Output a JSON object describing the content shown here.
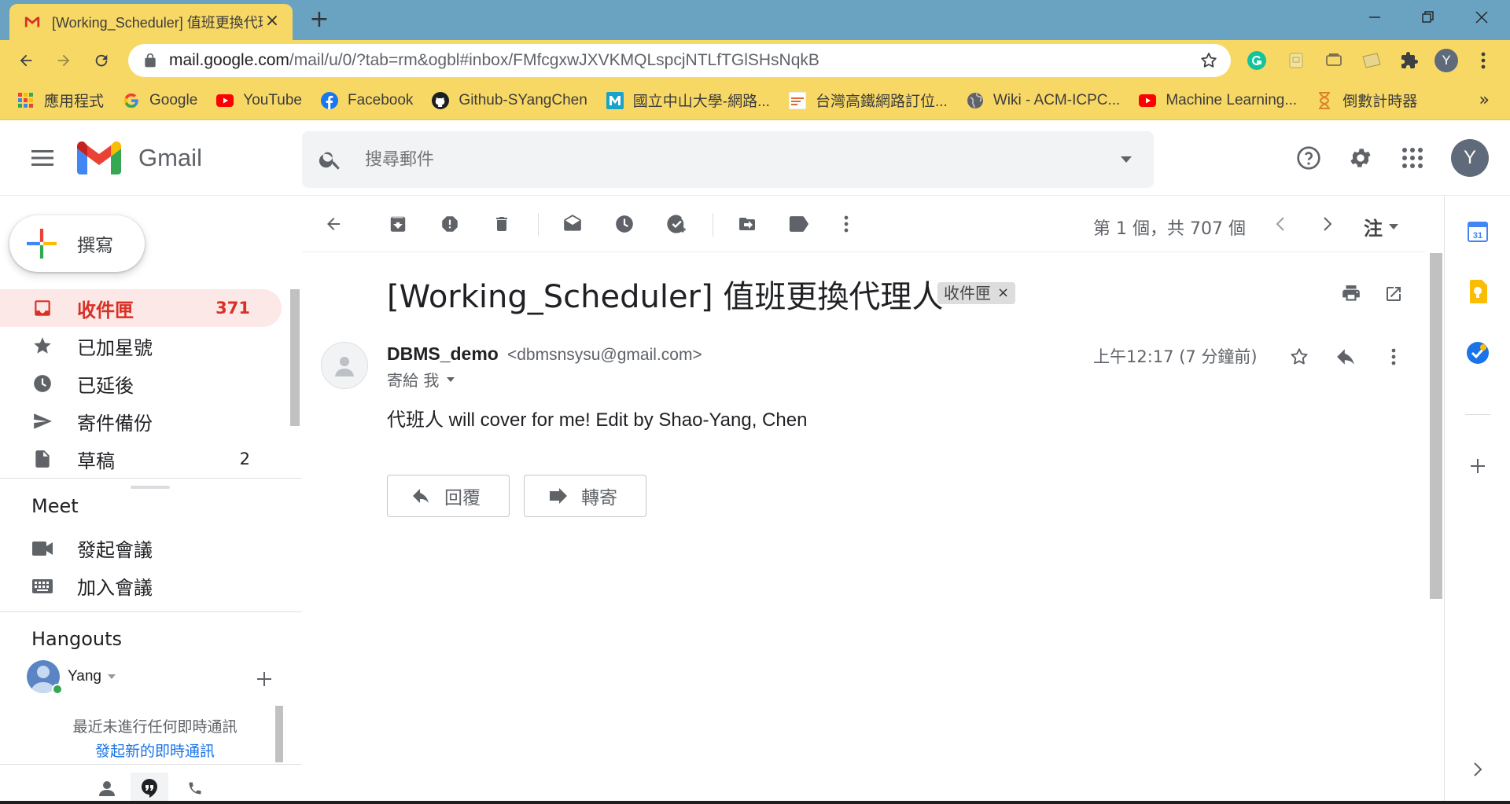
{
  "browser": {
    "tab_title": "[Working_Scheduler] 值班更換代理人 - dbmsnsysu@gmail.com - Gmail",
    "url_host": "mail.google.com",
    "url_path": "/mail/u/0/?tab=rm&ogbl#inbox/FMfcgxwJXVKMQLspcjNTLfTGlSHsNqkB",
    "profile_initial": "Y",
    "bookmarks": [
      {
        "label": "應用程式",
        "icon": "apps-grid-icon"
      },
      {
        "label": "Google",
        "icon": "google-icon"
      },
      {
        "label": "YouTube",
        "icon": "youtube-icon"
      },
      {
        "label": "Facebook",
        "icon": "facebook-icon"
      },
      {
        "label": "Github-SYangChen",
        "icon": "github-icon"
      },
      {
        "label": "國立中山大學-網路...",
        "icon": "m-icon"
      },
      {
        "label": "台灣高鐵網路訂位...",
        "icon": "thsr-icon"
      },
      {
        "label": "Wiki - ACM-ICPC...",
        "icon": "globe-icon"
      },
      {
        "label": "Machine Learning...",
        "icon": "youtube-icon"
      },
      {
        "label": "倒數計時器",
        "icon": "hourglass-icon"
      }
    ]
  },
  "gmail": {
    "brand": "Gmail",
    "search_placeholder": "搜尋郵件",
    "avatar_initial": "Y",
    "compose_label": "撰寫",
    "nav": [
      {
        "label": "收件匣",
        "count": "371",
        "icon": "inbox-icon",
        "active": true
      },
      {
        "label": "已加星號",
        "count": "",
        "icon": "star-icon"
      },
      {
        "label": "已延後",
        "count": "",
        "icon": "clock-icon"
      },
      {
        "label": "寄件備份",
        "count": "",
        "icon": "send-icon"
      },
      {
        "label": "草稿",
        "count": "2",
        "icon": "draft-icon"
      }
    ],
    "meet": {
      "title": "Meet",
      "start": "發起會議",
      "join": "加入會議"
    },
    "hangouts": {
      "title": "Hangouts",
      "user": "Yang",
      "empty_text": "最近未進行任何即時通訊",
      "start_link": "發起新的即時通訊"
    },
    "toolbar": {
      "pager": "第 1 個，共 707 個",
      "input_tool": "注"
    },
    "message": {
      "subject": "[Working_Scheduler] 值班更換代理人",
      "label": "收件匣",
      "sender_name": "DBMS_demo",
      "sender_email": "<dbmsnsysu@gmail.com>",
      "to": "寄給 我",
      "time": "上午12:17 (7 分鐘前)",
      "body": "代班人 will cover for me! Edit by Shao-Yang, Chen",
      "reply": "回覆",
      "forward": "轉寄"
    }
  },
  "colors": {
    "tabstrip": "#6aa3c2",
    "toolbar": "#f8d865",
    "active_nav_bg": "#fce8e6",
    "active_nav_text": "#d93025"
  }
}
